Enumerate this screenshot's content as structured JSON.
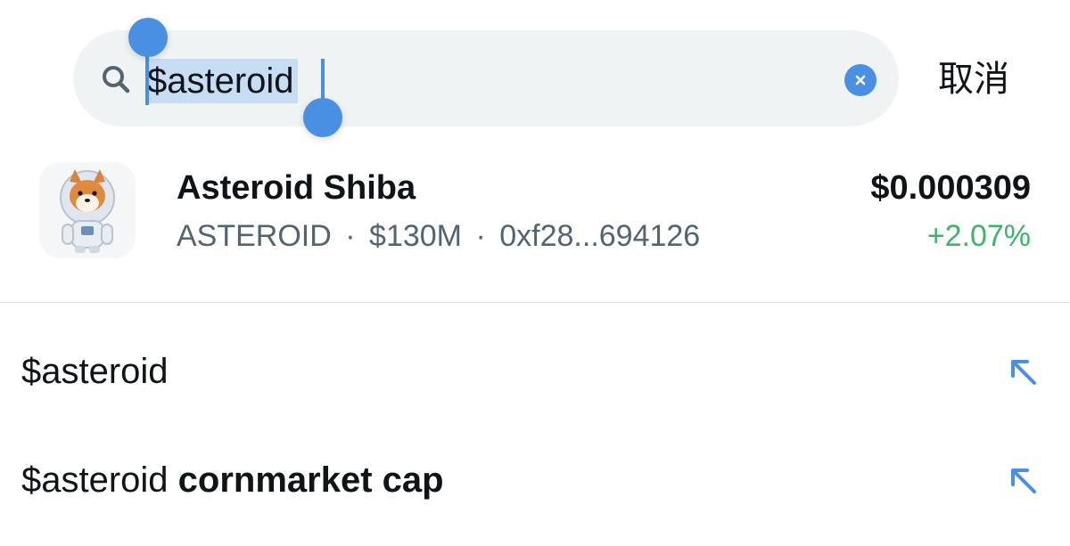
{
  "search": {
    "query": "$asteroid",
    "cancel_label": "取消"
  },
  "token": {
    "name": "Asteroid Shiba",
    "ticker": "ASTEROID",
    "market_cap": "$130M",
    "address": "0xf28...694126",
    "separator": "·",
    "price": "$0.000309",
    "change": "+2.07%",
    "avatar_icon": "shiba-astronaut-avatar"
  },
  "suggestions": [
    {
      "prefix": "$asteroid",
      "bold": ""
    },
    {
      "prefix": "$asteroid ",
      "bold": "cornmarket cap"
    }
  ],
  "colors": {
    "accent": "#4a90e2",
    "positive": "#3db36b",
    "muted": "#536471",
    "search_bg": "#eff3f4",
    "selection": "#c7ddf4"
  }
}
